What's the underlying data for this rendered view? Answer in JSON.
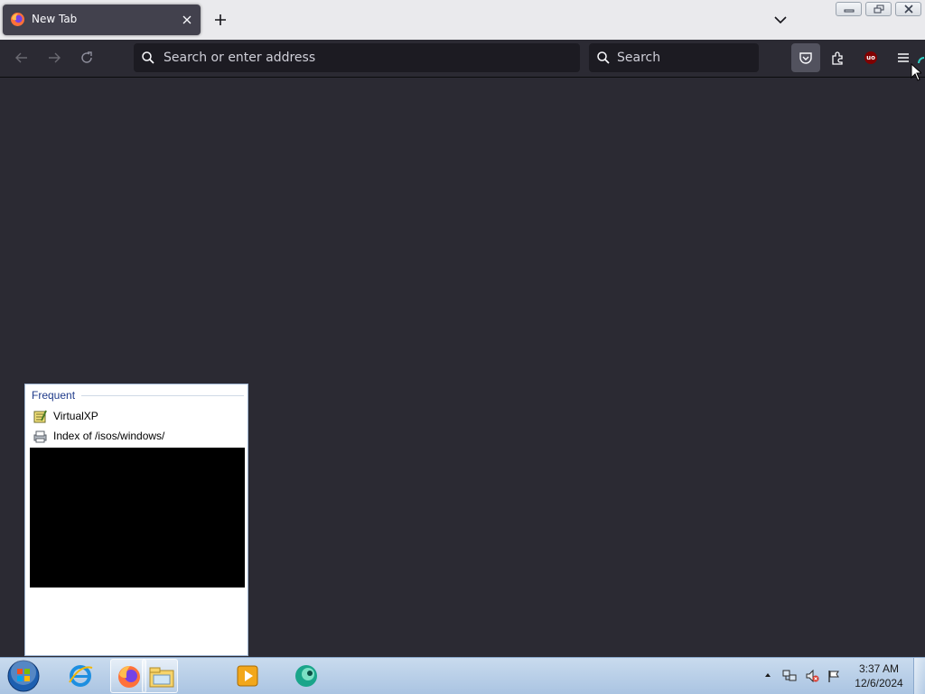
{
  "browser": {
    "tab": {
      "title": "New Tab",
      "close_label": "×"
    },
    "new_tab_label": "+",
    "urlbar": {
      "placeholder": "Search or enter address",
      "value": ""
    },
    "searchbar": {
      "placeholder": "Search",
      "value": ""
    },
    "ublock_badge": "uo",
    "accent_color": "#2b2a33"
  },
  "jumplist": {
    "heading": "Frequent",
    "items": [
      {
        "label": "VirtualXP",
        "icon": "notepad-icon"
      },
      {
        "label": "Index of /isos/windows/",
        "icon": "document-printer-icon"
      }
    ]
  },
  "taskbar": {
    "time": "3:37 AM",
    "date": "12/6/2024",
    "pinned": [
      "internet-explorer-icon",
      "firefox-icon",
      "file-explorer-icon",
      "media-player-icon",
      "chat-app-icon"
    ]
  }
}
